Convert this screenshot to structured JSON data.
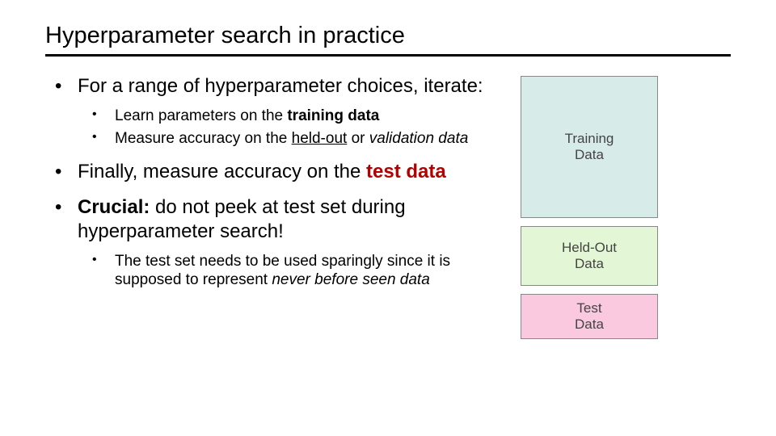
{
  "title": "Hyperparameter search in practice",
  "bullets": {
    "b1": {
      "pre": "For a range of hyperparameter choices, iterate:",
      "sub1_pre": "Learn parameters on the ",
      "sub1_bold": "training data",
      "sub2_pre": "Measure accuracy on the ",
      "sub2_underline": "held-out",
      "sub2_mid": " or ",
      "sub2_italic": "validation data"
    },
    "b2": {
      "pre": "Finally, measure accuracy on the ",
      "bold": "test data"
    },
    "b3": {
      "lead": "Crucial:",
      "rest": " do not peek at test set during hyperparameter search!",
      "sub1_pre": "The test set needs to be used sparingly since it is supposed to represent ",
      "sub1_italic": "never before seen data"
    }
  },
  "diagram": {
    "training": "Training\nData",
    "heldout": "Held-Out\nData",
    "test": "Test\nData"
  }
}
